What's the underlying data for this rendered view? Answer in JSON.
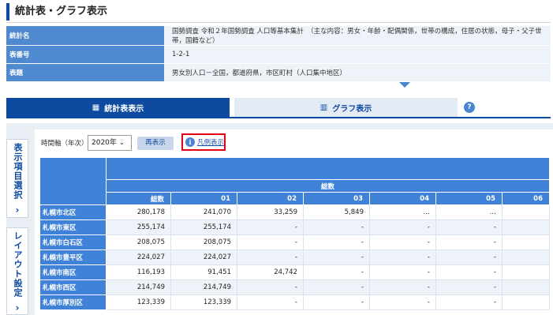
{
  "page": {
    "title": "統計表・グラフ表示"
  },
  "info": [
    {
      "key": "統計名",
      "value": "国勢調査 令和２年国勢調査 人口等基本集計　（主な内容：男女・年齢・配偶関係，世帯の構成，住居の状態，母子・父子世帯，国籍など）"
    },
    {
      "key": "表番号",
      "value": "1-2-1"
    },
    {
      "key": "表題",
      "value": "男女別人口－全国，都道府県，市区町村（人口集中地区）"
    }
  ],
  "tabs": {
    "table": "統計表表示",
    "graph": "グラフ表示",
    "help": "?"
  },
  "side": {
    "display_items": "表示項目選択",
    "layout": "レイアウト設定",
    "chevron": "›"
  },
  "controls": {
    "time_axis_label": "時間軸（年次）",
    "time_axis_value": "2020年",
    "redisplay": "再表示",
    "legend": "凡例表示",
    "legend_icon": "i"
  },
  "table": {
    "group_header": "総数",
    "columns": [
      "総数",
      "01",
      "02",
      "03",
      "04",
      "05",
      "06"
    ],
    "rows": [
      {
        "name": "札幌市北区",
        "values": [
          "280,178",
          "241,070",
          "33,259",
          "5,849",
          "…",
          "…",
          ""
        ]
      },
      {
        "name": "札幌市東区",
        "values": [
          "255,174",
          "255,174",
          "-",
          "-",
          "-",
          "-",
          ""
        ]
      },
      {
        "name": "札幌市白石区",
        "values": [
          "208,075",
          "208,075",
          "-",
          "-",
          "-",
          "-",
          ""
        ]
      },
      {
        "name": "札幌市豊平区",
        "values": [
          "224,027",
          "224,027",
          "-",
          "-",
          "-",
          "-",
          ""
        ]
      },
      {
        "name": "札幌市南区",
        "values": [
          "116,193",
          "91,451",
          "24,742",
          "-",
          "-",
          "-",
          ""
        ]
      },
      {
        "name": "札幌市西区",
        "values": [
          "214,749",
          "214,749",
          "-",
          "-",
          "-",
          "-",
          ""
        ]
      },
      {
        "name": "札幌市厚別区",
        "values": [
          "123,339",
          "123,339",
          "-",
          "-",
          "-",
          "-",
          ""
        ]
      }
    ]
  }
}
